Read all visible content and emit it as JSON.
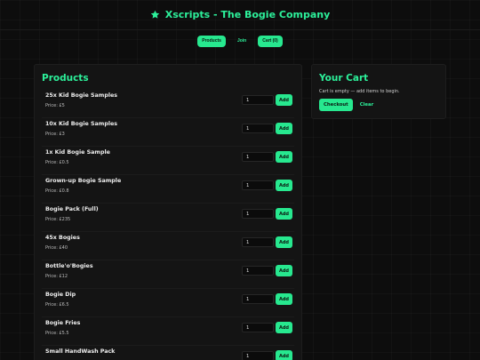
{
  "header": {
    "title": "Xscripts - The Bogie Company",
    "icon": "star-icon",
    "accent": "#2cf09a"
  },
  "nav": {
    "items": [
      {
        "label": "Products"
      },
      {
        "label": "Join"
      },
      {
        "label": "Cart (0)"
      }
    ]
  },
  "products": {
    "heading": "Products",
    "add_label": "Add",
    "items": [
      {
        "name": "25x Kid Bogie Samples",
        "price": "Price: £5",
        "qty": "1"
      },
      {
        "name": "10x Kid Bogie Samples",
        "price": "Price: £3",
        "qty": "1"
      },
      {
        "name": "1x Kid Bogie Sample",
        "price": "Price: £0.5",
        "qty": "1"
      },
      {
        "name": "Grown-up Bogie Sample",
        "price": "Price: £0.8",
        "qty": "1"
      },
      {
        "name": "Bogie Pack (Full)",
        "price": "Price: £235",
        "qty": "1"
      },
      {
        "name": "45x Bogies",
        "price": "Price: £40",
        "qty": "1"
      },
      {
        "name": "Bottle'o'Bogies",
        "price": "Price: £12",
        "qty": "1"
      },
      {
        "name": "Bogie Dip",
        "price": "Price: £6.5",
        "qty": "1"
      },
      {
        "name": "Bogie Fries",
        "price": "Price: £5.5",
        "qty": "1"
      },
      {
        "name": "Small HandWash Pack",
        "price": "",
        "qty": "1"
      }
    ]
  },
  "cart": {
    "heading": "Your Cart",
    "empty_text": "Cart is empty — add items to begin.",
    "checkout_label": "Checkout",
    "clear_label": "Clear"
  }
}
